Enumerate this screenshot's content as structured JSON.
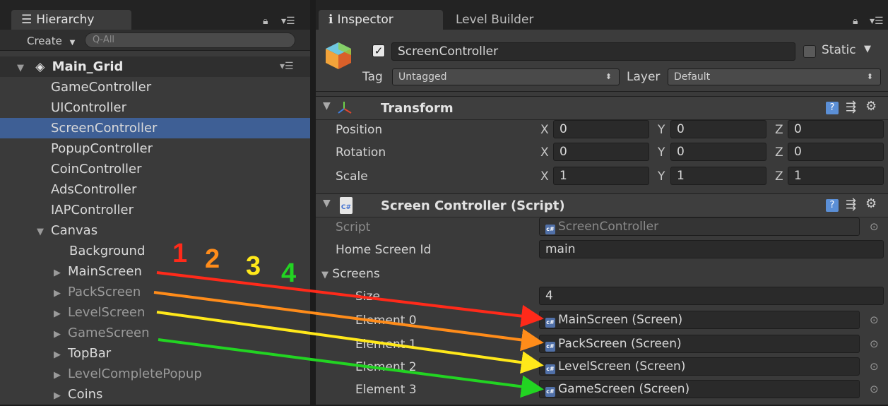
{
  "hierarchy": {
    "tab_label": "Hierarchy",
    "create_label": "Create",
    "search_placeholder": "Q‑All",
    "scene_name": "Main_Grid",
    "items": [
      {
        "label": "GameController"
      },
      {
        "label": "UIController"
      },
      {
        "label": "ScreenController"
      },
      {
        "label": "PopupController"
      },
      {
        "label": "CoinController"
      },
      {
        "label": "AdsController"
      },
      {
        "label": "IAPController"
      },
      {
        "label": "Canvas"
      },
      {
        "label": "Background"
      },
      {
        "label": "MainScreen"
      },
      {
        "label": "PackScreen"
      },
      {
        "label": "LevelScreen"
      },
      {
        "label": "GameScreen"
      },
      {
        "label": "TopBar"
      },
      {
        "label": "LevelCompletePopup"
      },
      {
        "label": "Coins"
      }
    ],
    "selected": "ScreenController"
  },
  "annotations": {
    "numbers": [
      "1",
      "2",
      "3",
      "4"
    ],
    "colors": [
      "#ff2a1a",
      "#ff8c1a",
      "#ffe81a",
      "#22d422"
    ]
  },
  "inspector": {
    "tab_label": "Inspector",
    "tab2_label": "Level Builder",
    "object_name": "ScreenController",
    "active": true,
    "static_label": "Static",
    "static_checked": false,
    "tag_label": "Tag",
    "tag_value": "Untagged",
    "layer_label": "Layer",
    "layer_value": "Default",
    "transform": {
      "title": "Transform",
      "position_label": "Position",
      "rotation_label": "Rotation",
      "scale_label": "Scale",
      "position": {
        "x": "0",
        "y": "0",
        "z": "0"
      },
      "rotation": {
        "x": "0",
        "y": "0",
        "z": "0"
      },
      "scale": {
        "x": "1",
        "y": "1",
        "z": "1"
      }
    },
    "script_component": {
      "title": "Screen Controller (Script)",
      "script_label": "Script",
      "script_value": "ScreenController",
      "home_label": "Home Screen Id",
      "home_value": "main",
      "screens_label": "Screens",
      "size_label": "Size",
      "size_value": "4",
      "elements": [
        {
          "label": "Element 0",
          "value": "MainScreen (Screen)"
        },
        {
          "label": "Element 1",
          "value": "PackScreen (Screen)"
        },
        {
          "label": "Element 2",
          "value": "LevelScreen (Screen)"
        },
        {
          "label": "Element 3",
          "value": "GameScreen (Screen)"
        }
      ]
    }
  }
}
